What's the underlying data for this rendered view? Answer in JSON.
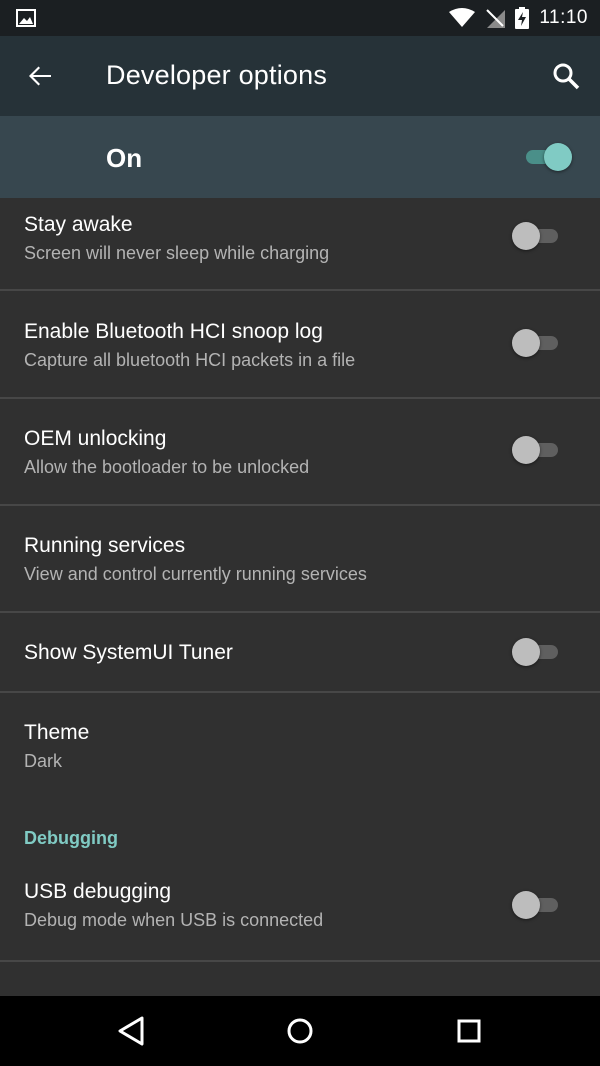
{
  "status_bar": {
    "time": "11:10",
    "icons": [
      "image-icon",
      "wifi-icon",
      "no-sim-icon",
      "battery-charging-icon"
    ]
  },
  "app_bar": {
    "title": "Developer options",
    "back_icon": "arrow-back-icon",
    "search_icon": "search-icon"
  },
  "master_switch": {
    "label": "On",
    "checked": true
  },
  "settings": [
    {
      "title": "Stay awake",
      "summary": "Screen will never sleep while charging",
      "toggle": true,
      "checked": false
    },
    {
      "title": "Enable Bluetooth HCI snoop log",
      "summary": "Capture all bluetooth HCI packets in a file",
      "toggle": true,
      "checked": false
    },
    {
      "title": "OEM unlocking",
      "summary": "Allow the bootloader to be unlocked",
      "toggle": true,
      "checked": false
    },
    {
      "title": "Running services",
      "summary": "View and control currently running services",
      "toggle": false
    },
    {
      "title": "Show SystemUI Tuner",
      "toggle": true,
      "checked": false
    },
    {
      "title": "Theme",
      "summary": "Dark",
      "toggle": false
    }
  ],
  "debugging": {
    "category": "Debugging",
    "items": [
      {
        "title": "USB debugging",
        "summary": "Debug mode when USB is connected",
        "toggle": true,
        "checked": false
      }
    ]
  },
  "colors": {
    "accent": "#80cbc4",
    "app_bar": "#263238",
    "switch_bar": "#37474f",
    "background": "#303030"
  },
  "nav_bar": {
    "icons": [
      "back-triangle-icon",
      "home-circle-icon",
      "recents-square-icon"
    ]
  }
}
